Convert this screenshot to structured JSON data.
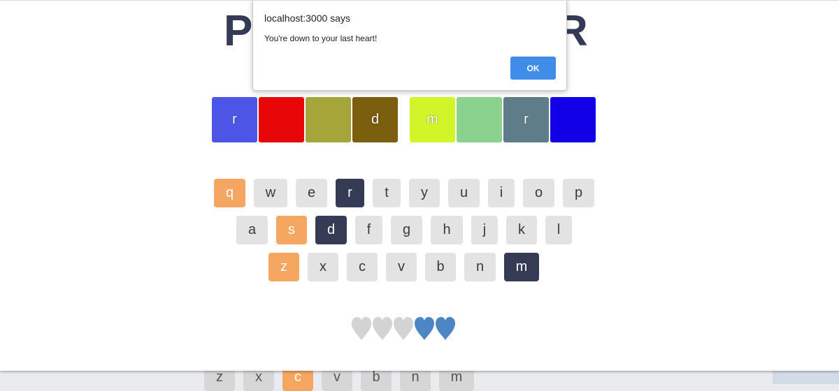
{
  "title": {
    "left": "P",
    "right": "R"
  },
  "tiles": [
    {
      "letter": "r",
      "color": "#4d55e6"
    },
    {
      "letter": "",
      "color": "#e80708"
    },
    {
      "letter": "",
      "color": "#a5a53a"
    },
    {
      "letter": "d",
      "color": "#7b5e0e"
    },
    {
      "letter": "m",
      "color": "#d2f52a"
    },
    {
      "letter": "",
      "color": "#8bd28e"
    },
    {
      "letter": "r",
      "color": "#5f7d88"
    },
    {
      "letter": "",
      "color": "#1200e6"
    }
  ],
  "keyboard": {
    "row1": [
      "q",
      "w",
      "e",
      "r",
      "t",
      "y",
      "u",
      "i",
      "o",
      "p"
    ],
    "row2": [
      "a",
      "s",
      "d",
      "f",
      "g",
      "h",
      "j",
      "k",
      "l"
    ],
    "row3": [
      "z",
      "x",
      "c",
      "v",
      "b",
      "n",
      "m"
    ]
  },
  "background_keys": [
    "z",
    "x",
    "c",
    "v",
    "b",
    "n",
    "m"
  ],
  "hearts": {
    "total": 5,
    "lost": 3,
    "lost_color": "#d3d3d3",
    "remaining_color": "#4d86c4"
  },
  "dialog": {
    "origin": "localhost:3000 says",
    "message": "You're down to your last heart!",
    "ok_label": "OK"
  },
  "colors": {
    "hint": "#f5a660",
    "used": "#353b55",
    "key": "#e3e3e3"
  }
}
